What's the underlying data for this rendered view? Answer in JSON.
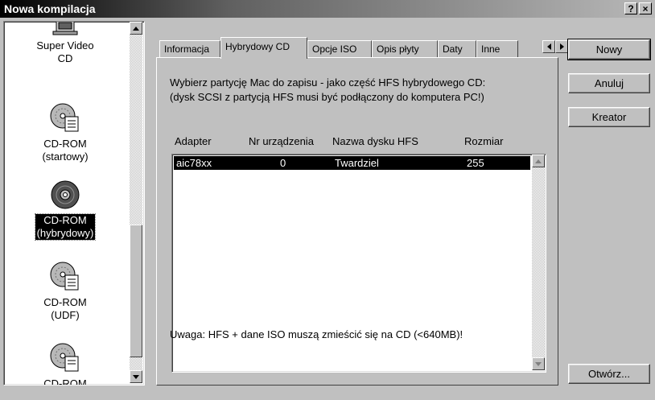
{
  "window": {
    "title": "Nowa kompilacja",
    "help_glyph": "?",
    "close_glyph": "×"
  },
  "compilations": [
    {
      "label": "Super Video CD",
      "line1": "Super Video",
      "line2": "CD",
      "icon": "video-cd-icon",
      "selected": false
    },
    {
      "label": "CD-ROM (startowy)",
      "line1": "CD-ROM",
      "line2": "(startowy)",
      "icon": "cd-rom-bootable-icon",
      "selected": false
    },
    {
      "label": "CD-ROM (hybrydowy)",
      "line1": "CD-ROM",
      "line2": "(hybrydowy)",
      "icon": "cd-rom-hybrid-icon",
      "selected": true
    },
    {
      "label": "CD-ROM (UDF)",
      "line1": "CD-ROM",
      "line2": "(UDF)",
      "icon": "cd-rom-udf-icon",
      "selected": false
    },
    {
      "label": "CD-ROM",
      "line1": "CD-ROM",
      "line2": "",
      "icon": "cd-rom-icon",
      "selected": false
    }
  ],
  "tabs": [
    {
      "label": "Informacja",
      "active": false
    },
    {
      "label": "Hybrydowy CD",
      "active": true
    },
    {
      "label": "Opcje ISO",
      "active": false
    },
    {
      "label": "Opis płyty",
      "active": false
    },
    {
      "label": "Daty",
      "active": false
    },
    {
      "label": "Inne",
      "active": false
    }
  ],
  "panel": {
    "description_line1": "Wybierz partycję Mac do zapisu - jako część HFS hybrydowego CD:",
    "description_line2": "(dysk SCSI z partycją HFS musi być podłączony do komputera PC!)",
    "columns": [
      "Adapter",
      "Nr urządzenia",
      "Nazwa dysku HFS",
      "Rozmiar"
    ],
    "rows": [
      {
        "adapter": "aic78xx",
        "device": "0",
        "name": "Twardziel",
        "size": "255",
        "selected": true
      }
    ],
    "note": "Uwaga: HFS + dane ISO muszą zmieścić się na CD (<640MB)!"
  },
  "buttons": {
    "new": "Nowy",
    "cancel": "Anuluj",
    "wizard": "Kreator",
    "open": "Otwórz..."
  }
}
